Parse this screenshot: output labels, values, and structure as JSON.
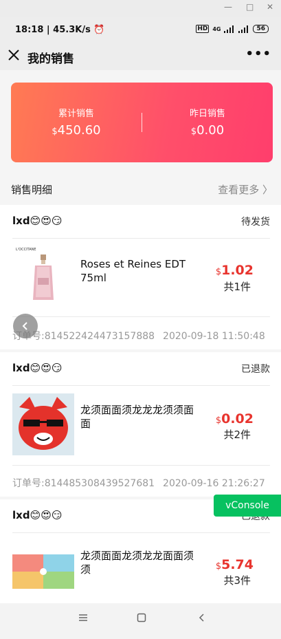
{
  "window_controls": {
    "minimize": "—",
    "maximize": "□",
    "close": "✕"
  },
  "statusbar": {
    "time": "18:18 | 45.3K/s",
    "battery": "56",
    "hd": "HD",
    "net": "4G"
  },
  "header": {
    "title": "我的销售",
    "more": "•••"
  },
  "summary": {
    "total_label": "累计销售",
    "total_currency": "$",
    "total_value": "450.60",
    "yesterday_label": "昨日销售",
    "yesterday_currency": "$",
    "yesterday_value": "0.00"
  },
  "section": {
    "title": "销售明细",
    "more": "查看更多 〉"
  },
  "orders": [
    {
      "user": "lxd😊😍😏",
      "status": "待发货",
      "product": "Roses et Reines EDT 75ml",
      "currency": "$",
      "price": "1.02",
      "qty": "共1件",
      "order_no": "订单号:814522424473157888",
      "date": "2020-09-18 11:50:48",
      "thumb_brand": "L'OCCITANE"
    },
    {
      "user": "lxd😊😍😏",
      "status": "已退款",
      "product": "龙须面面须龙龙龙须须面面",
      "currency": "$",
      "price": "0.02",
      "qty": "共2件",
      "order_no": "订单号:814485308439527681",
      "date": "2020-09-16 21:26:27"
    },
    {
      "user": "lxd😊😍😏",
      "status": "已退款",
      "product": "龙须面面龙须龙龙面面须须",
      "currency": "$",
      "price": "5.74",
      "qty": "共3件"
    }
  ],
  "vconsole": {
    "label": "vConsole"
  },
  "colors": {
    "accent": "#e8342e",
    "card_start": "#ff7b53",
    "card_end": "#ff3e6c",
    "vconsole": "#07c160"
  }
}
